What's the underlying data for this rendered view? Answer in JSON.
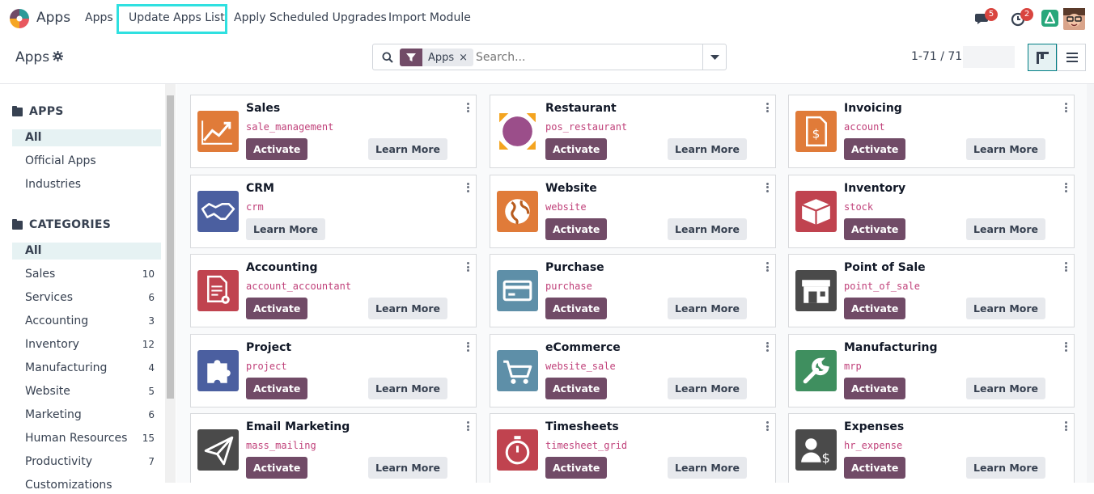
{
  "navbar": {
    "brand": "Apps",
    "menu": [
      "Apps",
      "Update Apps List",
      "Apply Scheduled Upgrades",
      "Import Module"
    ],
    "messages_badge": "5",
    "activities_badge": "2"
  },
  "control_panel": {
    "title": "Apps",
    "facet": "Apps",
    "search_placeholder": "Search...",
    "pager": "1-71 / 71"
  },
  "sidebar": {
    "apps_heading": "APPS",
    "apps_items": [
      "All",
      "Official Apps",
      "Industries"
    ],
    "categories_heading": "CATEGORIES",
    "categories": [
      {
        "label": "All",
        "count": ""
      },
      {
        "label": "Sales",
        "count": "10"
      },
      {
        "label": "Services",
        "count": "6"
      },
      {
        "label": "Accounting",
        "count": "3"
      },
      {
        "label": "Inventory",
        "count": "12"
      },
      {
        "label": "Manufacturing",
        "count": "4"
      },
      {
        "label": "Website",
        "count": "5"
      },
      {
        "label": "Marketing",
        "count": "6"
      },
      {
        "label": "Human Resources",
        "count": "15"
      },
      {
        "label": "Productivity",
        "count": "7"
      },
      {
        "label": "Customizations",
        "count": ""
      }
    ]
  },
  "apps": [
    {
      "name": "Sales",
      "tech": "sale_management",
      "installed": false,
      "icon": "chart-icon",
      "color": "#e07b39"
    },
    {
      "name": "Restaurant",
      "tech": "pos_restaurant",
      "installed": false,
      "icon": "restaurant-icon",
      "color": "#f4a41f"
    },
    {
      "name": "Invoicing",
      "tech": "account",
      "installed": false,
      "icon": "invoice-icon",
      "color": "#e07b39"
    },
    {
      "name": "CRM",
      "tech": "crm",
      "installed": true,
      "icon": "handshake-icon",
      "color": "#4b5fa0"
    },
    {
      "name": "Website",
      "tech": "website",
      "installed": false,
      "icon": "globe-icon",
      "color": "#e07b39"
    },
    {
      "name": "Inventory",
      "tech": "stock",
      "installed": false,
      "icon": "box-icon",
      "color": "#c0434f"
    },
    {
      "name": "Accounting",
      "tech": "account_accountant",
      "installed": false,
      "icon": "document-gear-icon",
      "color": "#c0434f"
    },
    {
      "name": "Purchase",
      "tech": "purchase",
      "installed": false,
      "icon": "card-icon",
      "color": "#5e8fa8"
    },
    {
      "name": "Point of Sale",
      "tech": "point_of_sale",
      "installed": false,
      "icon": "store-icon",
      "color": "#4a4a4a"
    },
    {
      "name": "Project",
      "tech": "project",
      "installed": false,
      "icon": "puzzle-icon",
      "color": "#4b5fa0"
    },
    {
      "name": "eCommerce",
      "tech": "website_sale",
      "installed": false,
      "icon": "cart-icon",
      "color": "#5e8fa8"
    },
    {
      "name": "Manufacturing",
      "tech": "mrp",
      "installed": false,
      "icon": "wrench-icon",
      "color": "#3f8f5f"
    },
    {
      "name": "Email Marketing",
      "tech": "mass_mailing",
      "installed": false,
      "icon": "paper-plane-icon",
      "color": "#4a4a4a"
    },
    {
      "name": "Timesheets",
      "tech": "timesheet_grid",
      "installed": false,
      "icon": "stopwatch-icon",
      "color": "#c0434f"
    },
    {
      "name": "Expenses",
      "tech": "hr_expense",
      "installed": false,
      "icon": "user-dollar-icon",
      "color": "#4a4a4a"
    }
  ],
  "labels": {
    "activate": "Activate",
    "learn_more": "Learn More"
  }
}
